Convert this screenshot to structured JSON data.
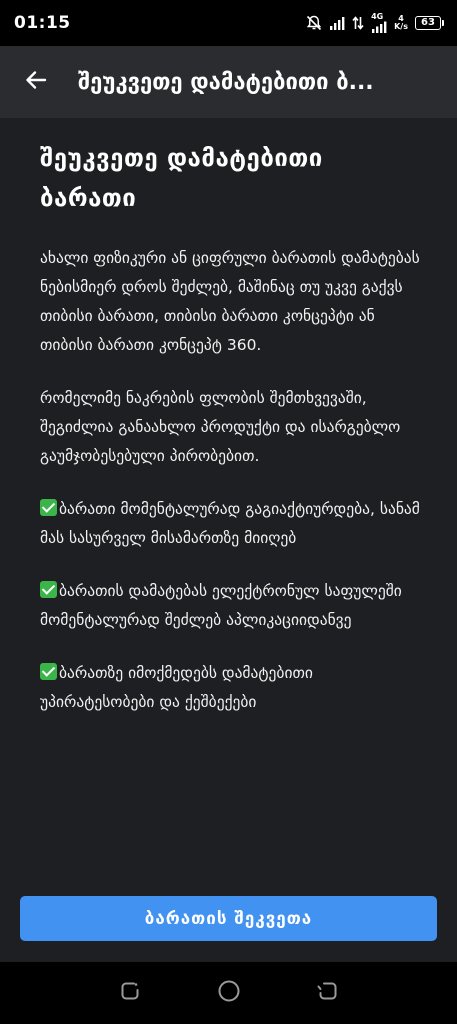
{
  "status_bar": {
    "time": "01:15",
    "network": "4G",
    "speed_value": "4",
    "speed_unit": "K/s",
    "battery": "63"
  },
  "app_bar": {
    "title": "შეუკვეთე დამატებითი ბ..."
  },
  "main": {
    "title": "შეუკვეთე დამატებითი ბარათი",
    "intro": "ახალი ფიზიკური ან ციფრული ბარათის დამატებას ნებისმიერ დროს შეძლებ, მაშინაც თუ უკვე გაქვს თიბისი ბარათი, თიბისი ბარათი კონცეპტი ან თიბისი ბარათი კონცეპტ 360.",
    "second": "რომელიმე ნაკრების ფლობის შემთხვევაში, შეგიძლია განაახლო პროდუქტი და ისარგებლო გაუმჯობესებული პირობებით.",
    "benefits": [
      "ბარათი მომენტალურად გაგიაქტიურდება, სანამ მას სასურველ მისამართზე მიიღებ",
      "ბარათის დამატებას ელექტრონულ საფულეში მომენტალურად შეძლებ აპლიკაციიდანვე",
      "ბარათზე იმოქმედებს დამატებითი უპირატესობები და ქეშბექები"
    ]
  },
  "order_button": {
    "label": "ბარათის შეკვეთა"
  },
  "icons": {
    "back": "arrow-left-icon",
    "check": "check-mark-icon"
  },
  "colors": {
    "background": "#1e1f22",
    "app_bar": "#2b2c30",
    "accent": "#4292f2",
    "check": "#3bb54a"
  }
}
